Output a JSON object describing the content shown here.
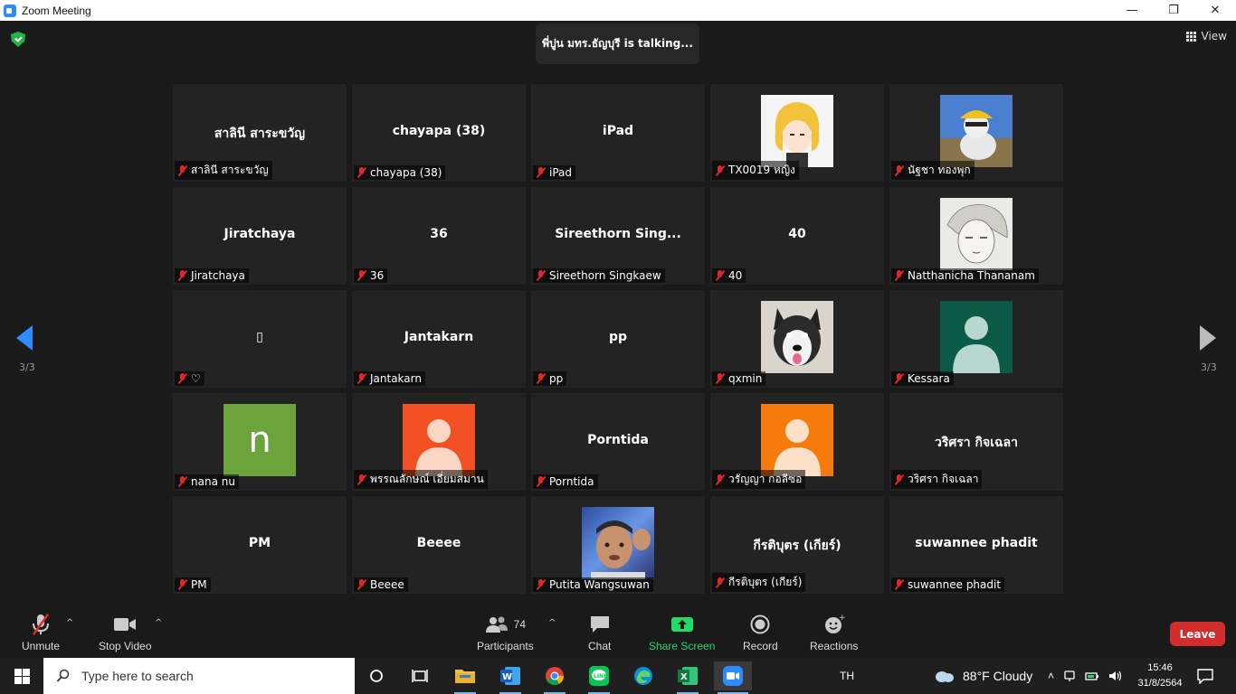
{
  "window": {
    "title": "Zoom Meeting",
    "minimize": "—",
    "restore": "❐",
    "close": "✕"
  },
  "meeting": {
    "talking_text": "พี่ปูน มทร.ธัญบุรี is  talking...",
    "view_label": "View",
    "page_left": "3/3",
    "page_right": "3/3"
  },
  "tiles": [
    {
      "big": "สาลินี สาระขวัญ",
      "label": "สาลินี สาระขวัญ"
    },
    {
      "big": "chayapa (38)",
      "label": "chayapa (38)"
    },
    {
      "big": "iPad",
      "label": "iPad"
    },
    {
      "avatar": "cartoon-girl",
      "label": "TX0019 หญิง"
    },
    {
      "avatar": "cat-photo",
      "label": "นัฐชา ทองพุก"
    },
    {
      "big": "Jiratchaya",
      "label": "Jiratchaya"
    },
    {
      "big": "36",
      "label": "36"
    },
    {
      "big": "Sireethorn  Sing...",
      "label": "Sireethorn Singkaew"
    },
    {
      "big": "40",
      "label": "40"
    },
    {
      "avatar": "anime-sketch",
      "label": "Natthanicha Thananam"
    },
    {
      "big": "▯",
      "label": "♡"
    },
    {
      "big": "Jantakarn",
      "label": "Jantakarn"
    },
    {
      "big": "pp",
      "label": "pp"
    },
    {
      "avatar": "husky-drawing",
      "label": "qxmin"
    },
    {
      "avatar": "person-teal",
      "label": "Kessara"
    },
    {
      "avatar": "letter",
      "letter": "n",
      "label": "nana nu"
    },
    {
      "avatar": "person-orange-red",
      "label": "พรรณลักษณ์ เอี่ยมสมาน"
    },
    {
      "big": "Porntida",
      "label": "Porntida"
    },
    {
      "avatar": "person-orange",
      "label": "วรัญญา กอลีซอ"
    },
    {
      "big": "วริศรา กิจเฉลา",
      "label": "วริศรา กิจเฉลา"
    },
    {
      "big": "PM",
      "label": "PM"
    },
    {
      "big": "Beeee",
      "label": "Beeee"
    },
    {
      "avatar": "selfie-photo",
      "label": "Putita Wangsuwan"
    },
    {
      "big": "กีรติบุตร (เกียร์)",
      "label": "กีรติบุตร (เกียร์)"
    },
    {
      "big": "suwannee phadit",
      "label": "suwannee phadit"
    }
  ],
  "toolbar": {
    "unmute": "Unmute",
    "stop_video": "Stop Video",
    "participants": "Participants",
    "participant_count": "74",
    "chat": "Chat",
    "share_screen": "Share Screen",
    "record": "Record",
    "reactions": "Reactions",
    "leave": "Leave"
  },
  "taskbar": {
    "search_placeholder": "Type here to search",
    "language": "TH",
    "weather": "88°F  Cloudy",
    "time": "15:46",
    "date": "31/8/2564"
  },
  "colors": {
    "accent": "#2d8cff",
    "share_green": "#23d96a",
    "leave_red": "#d12d2d",
    "muted_red": "#e02828"
  }
}
